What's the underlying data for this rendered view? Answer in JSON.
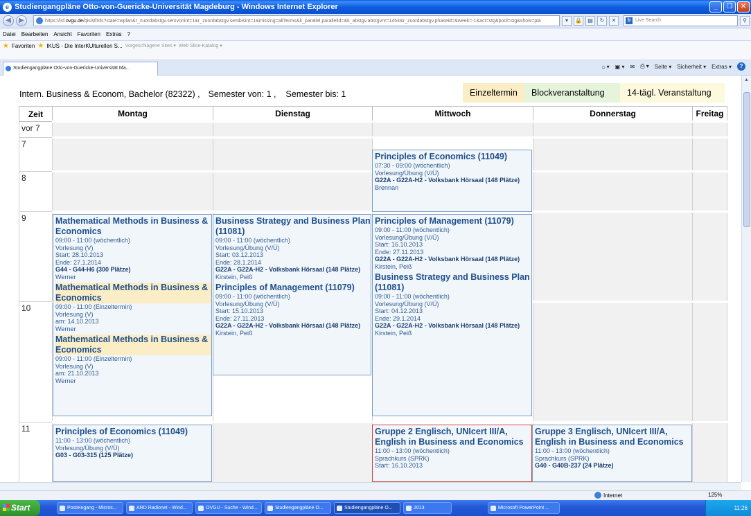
{
  "window": {
    "title": "Studiengangpläne Otto-von-Guericke-Universität Magdeburg - Windows Internet Explorer",
    "url_prefix": "https://lsf.",
    "url_domain": "ovgu.de",
    "url_rest": "/qislsf/rds?state=wplan&r_zuordabstgv.semvonint=1&r_zuordabstgv.sembisint=1&missing=allTerms&k_parallel.parallelid=&k_abstgv.abstgvnr=1454&r_zuordabstgv.phaseid=&week=-1&act=stg&pool=stg&show=pla",
    "search_placeholder": "Live Search"
  },
  "menu": [
    "Datei",
    "Bearbeiten",
    "Ansicht",
    "Favoriten",
    "Extras",
    "?"
  ],
  "favorites": {
    "label": "Favoriten",
    "items": [
      "IKUS - Die InterKUlturellen S...",
      "Vorgeschlagene Sites ▾",
      "Web Slice-Katalog ▾"
    ]
  },
  "tab": {
    "label": "Studiengangpläne Otto-von-Guericke-Universität Ma..."
  },
  "commands": [
    "Seite ▾",
    "Sicherheit ▾",
    "Extras ▾"
  ],
  "header": {
    "program": "Intern. Business & Econom, Bachelor (82322) ,",
    "sem_from": "Semester von: 1 ,",
    "sem_to": "Semester bis: 1"
  },
  "legend": {
    "einzel": "Einzeltermin",
    "block": "Blockveranstaltung",
    "twoweek": "14-tägl. Veranstaltung"
  },
  "columns": [
    "Zeit",
    "Montag",
    "Dienstag",
    "Mittwoch",
    "Donnerstag",
    "Freitag"
  ],
  "times": [
    "vor 7",
    "7",
    "8",
    "9",
    "10",
    "11"
  ],
  "events": {
    "wed_pe": {
      "title": "Principles of Economics (11049)",
      "lines": [
        "07:30 - 09:00 (wöchentlich)",
        "Vorlesung/Übung (V/Ü)"
      ],
      "room": "G22A - G22A-H2 - Volksbank Hörsaal (148 Plätze)",
      "person": "Brennan"
    },
    "mon_mm": [
      {
        "title": "Mathematical Methods in Business & Economics",
        "lines": [
          "09:00 - 11:00 (wöchentlich)",
          "Vorlesung (V)",
          "Start: 28.10.2013",
          "Ende: 27.1.2014"
        ],
        "room": "G44 - G44-H6 (300 Plätze)",
        "person": "Werner"
      },
      {
        "title": "Mathematical Methods in Business & Economics",
        "lines": [
          "09:00 - 11:00 (Einzeltermin)",
          "Vorlesung (V)",
          "am: 14.10.2013"
        ],
        "person": "Werner"
      },
      {
        "title": "Mathematical Methods in Business & Economics",
        "lines": [
          "09:00 - 11:00 (Einzeltermin)",
          "Vorlesung (V)",
          "am: 21.10.2013"
        ],
        "person": "Werner"
      }
    ],
    "tue": [
      {
        "title": "Business Strategy and Business Plan (11081)",
        "lines": [
          "09:00 - 11:00 (wöchentlich)",
          "Vorlesung/Übung (V/Ü)",
          "Start: 03.12.2013",
          "Ende: 28.1.2014"
        ],
        "room": "G22A - G22A-H2 - Volksbank Hörsaal (148 Plätze)",
        "person": "Kirstein, Peiß"
      },
      {
        "title": "Principles of Management (11079)",
        "lines": [
          "09:00 - 11:00 (wöchentlich)",
          "Vorlesung/Übung (V/Ü)",
          "Start: 15.10.2013",
          "Ende: 27.11.2013"
        ],
        "room": "G22A - G22A-H2 - Volksbank Hörsaal (148 Plätze)",
        "person": "Kirstein, Peiß"
      }
    ],
    "wed_9": [
      {
        "title": "Principles of Management (11079)",
        "lines": [
          "09:00 - 11:00 (wöchentlich)",
          "Vorlesung/Übung (V/Ü)",
          "Start: 16.10.2013",
          "Ende: 27.11.2013"
        ],
        "room": "G22A - G22A-H2 - Volksbank Hörsaal (148 Plätze)",
        "person": "Kirstein, Peiß"
      },
      {
        "title": "Business Strategy and Business Plan (11081)",
        "lines": [
          "09:00 - 11:00 (wöchentlich)",
          "Vorlesung/Übung (V/Ü)",
          "Start: 04.12.2013",
          "Ende: 29.1.2014"
        ],
        "room": "G22A - G22A-H2 - Volksbank Hörsaal (148 Plätze)",
        "person": "Kirstein, Peiß"
      }
    ],
    "mon_pe11": {
      "title": "Principles of Economics (11049)",
      "lines": [
        "11:00 - 13:00 (wöchentlich)",
        "Vorlesung/Übung (V/Ü)"
      ],
      "room": "G03 - G03-315 (125 Plätze)"
    },
    "wed_eng": {
      "title": "Gruppe 2 Englisch, UNIcert III/A, English in Business and Economics",
      "lines": [
        "11:00 - 13:00 (wöchentlich)",
        "Sprachkurs (SPRK)",
        "Start: 16.10.2013"
      ]
    },
    "thu_eng": {
      "title": "Gruppe 3 Englisch, UNIcert III/A, English in Business and Economics",
      "lines": [
        "11:00 - 13:00 (wöchentlich)",
        "Sprachkurs (SPRK)"
      ],
      "room": "G40 - G40B-237 (24 Plätze)"
    }
  },
  "status": {
    "zone": "Internet",
    "zoom": "125%"
  },
  "taskbar": {
    "start": "Start",
    "tasks": [
      "Posteingang - Micros...",
      "ARD Radionet - Wind...",
      "OVGU - Suche - Wind...",
      "Studiengangpläne O...",
      "Studiengangpläne O...",
      "2013",
      "Microsoft PowerPoint ..."
    ],
    "clock": "11:26"
  }
}
